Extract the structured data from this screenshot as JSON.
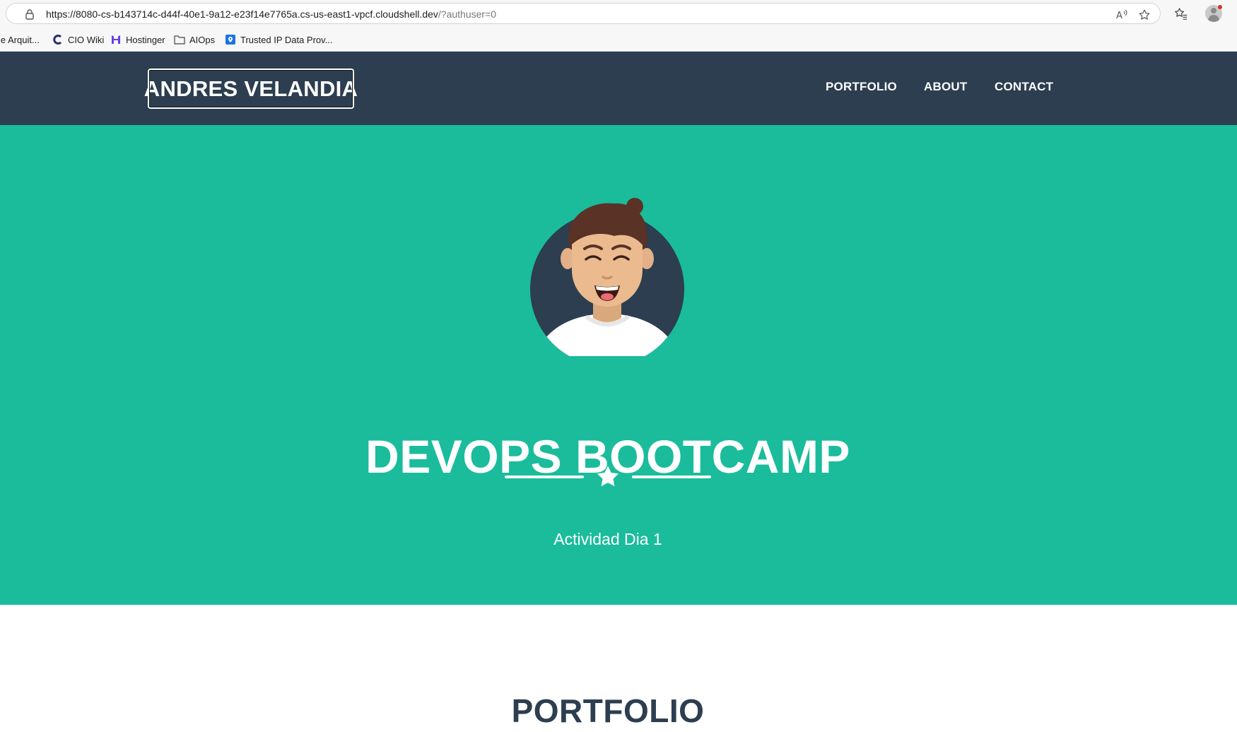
{
  "browser": {
    "url_main": "https://8080-cs-b143714c-d44f-40e1-9a12-e23f14e7765a.cs-us-east1-vpcf.cloudshell.dev",
    "url_rest": "/?authuser=0",
    "bookmarks": [
      {
        "label": "le Arquit...",
        "icon": "page-icon"
      },
      {
        "label": "CIO Wiki",
        "icon": "cio-wiki-icon"
      },
      {
        "label": "Hostinger",
        "icon": "hostinger-icon"
      },
      {
        "label": "AIOps",
        "icon": "folder-icon"
      },
      {
        "label": "Trusted IP Data Prov...",
        "icon": "ip-data-icon"
      }
    ]
  },
  "site": {
    "brand": "ANDRES VELANDIA",
    "nav": {
      "portfolio": "PORTFOLIO",
      "about": "ABOUT",
      "contact": "CONTACT"
    },
    "masthead": {
      "title": "DEVOPS BOOTCAMP",
      "subtitle": "Actividad Dia 1",
      "divider_icon": "star-icon"
    },
    "sections": {
      "portfolio_heading": "PORTFOLIO"
    }
  },
  "colors": {
    "nav_bg": "#2c3e50",
    "masthead_bg": "#1abc9c",
    "heading_text": "#2c3e50"
  }
}
